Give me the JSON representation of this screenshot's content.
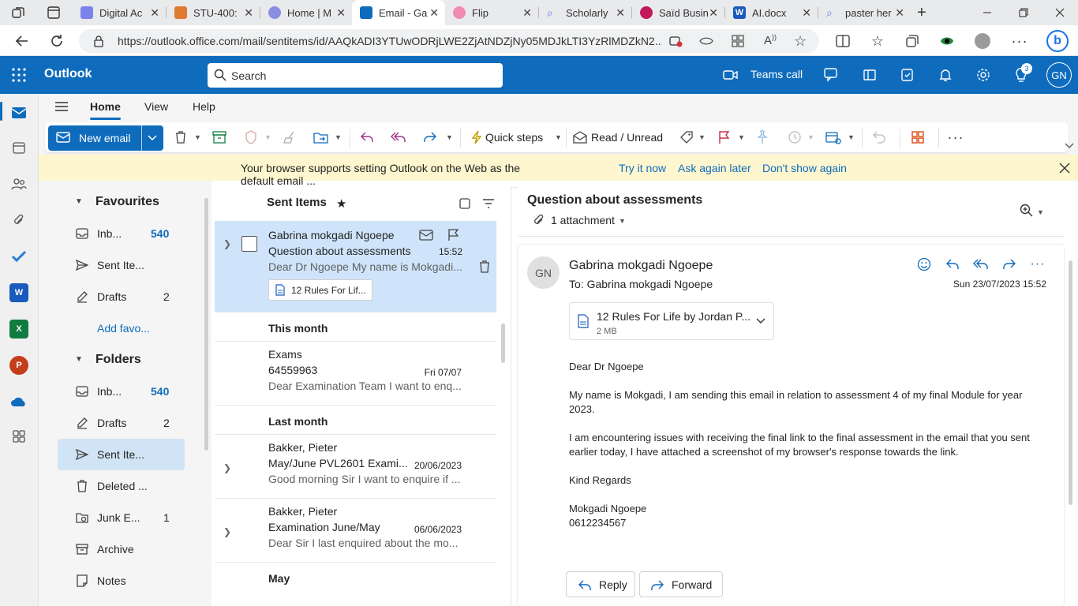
{
  "browser": {
    "tabs": [
      {
        "label": "Digital Ac",
        "color": "#7b83eb"
      },
      {
        "label": "STU-400:",
        "color": "#e07a2e"
      },
      {
        "label": "Home | M",
        "color": "#8a8ee0"
      },
      {
        "label": "Email - Ga",
        "color": "#0f6cbd"
      },
      {
        "label": "Flip",
        "color": "#f08ab0"
      },
      {
        "label": "Scholarly",
        "color": "#5c7cfa"
      },
      {
        "label": "Saïd Busin",
        "color": "#c2185b"
      },
      {
        "label": "AI.docx",
        "color": "#185abd"
      },
      {
        "label": "paster her",
        "color": "#5c7cfa"
      }
    ],
    "url": "https://outlook.office.com/mail/sentitems/id/AAQkADI3YTUwODRjLWE2ZjAtNDZjNy05MDJkLTI3YzRlMDZkN2..."
  },
  "header": {
    "brand": "Outlook",
    "search_label": "Search",
    "teams_call": "Teams call",
    "notification_badge": "3",
    "user_initials": "GN"
  },
  "ribbon_tabs": [
    "Home",
    "View",
    "Help"
  ],
  "ribbon": {
    "new_email": "New email",
    "quick_steps": "Quick steps",
    "read_unread": "Read / Unread"
  },
  "infobar": {
    "message": "Your browser supports setting Outlook on the Web as the default email ...",
    "try": "Try it now",
    "ask_later": "Ask again later",
    "dont_show": "Don't show again"
  },
  "folders": {
    "favourites_title": "Favourites",
    "favourites": [
      {
        "label": "Inb...",
        "count": "540"
      },
      {
        "label": "Sent Ite...",
        "count": ""
      },
      {
        "label": "Drafts",
        "count": "2"
      },
      {
        "label": "Add favo...",
        "count": ""
      }
    ],
    "folders_title": "Folders",
    "items": [
      {
        "label": "Inb...",
        "count": "540"
      },
      {
        "label": "Drafts",
        "count": "2"
      },
      {
        "label": "Sent Ite...",
        "count": ""
      },
      {
        "label": "Deleted ...",
        "count": ""
      },
      {
        "label": "Junk E...",
        "count": "1"
      },
      {
        "label": "Archive",
        "count": ""
      },
      {
        "label": "Notes",
        "count": ""
      }
    ]
  },
  "list": {
    "title": "Sent Items",
    "selected": {
      "from": "Gabrina mokgadi Ngoepe",
      "subject": "Question about assessments",
      "time": "15:52",
      "preview": "Dear Dr Ngoepe My name is Mokgadi...",
      "attachment": "12 Rules For Lif..."
    },
    "groups": [
      "This month",
      "Last month",
      "May"
    ],
    "messages": [
      {
        "from": "Exams",
        "subject": "64559963",
        "date": "Fri 07/07",
        "preview": "Dear Examination Team I want to enq..."
      },
      {
        "from": "Bakker, Pieter",
        "subject": "May/June PVL2601 Exami...",
        "date": "20/06/2023",
        "preview": "Good morning Sir I want to enquire if ..."
      },
      {
        "from": "Bakker, Pieter",
        "subject": "Examination June/May",
        "date": "06/06/2023",
        "preview": "Dear Sir I last enquired about the mo..."
      }
    ]
  },
  "reading": {
    "subject": "Question about assessments",
    "attachment_count": "1 attachment",
    "sender_initials": "GN",
    "sender": "Gabrina mokgadi Ngoepe",
    "to": "To:  Gabrina mokgadi Ngoepe",
    "date": "Sun 23/07/2023 15:52",
    "attachment_name": "12 Rules For Life by Jordan P...",
    "attachment_size": "2 MB",
    "body": [
      "Dear Dr Ngoepe",
      "My name is Mokgadi, I am sending this email in relation to assessment 4 of my final Module for year 2023.",
      "I am encountering issues with receiving the final link to the final assessment in the email that you sent earlier today, I have attached a screenshot of my browser's response towards the link.",
      "Kind Regards",
      "Mokgadi Ngoepe",
      "0612234567"
    ],
    "reply": "Reply",
    "forward": "Forward"
  }
}
